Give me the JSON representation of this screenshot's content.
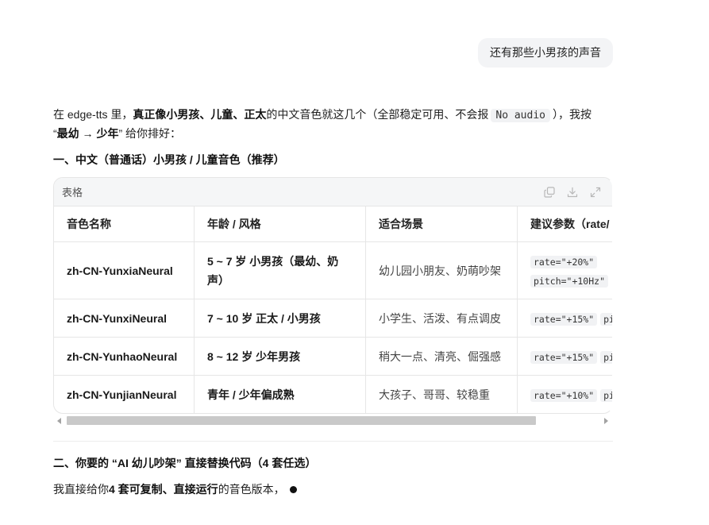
{
  "theme": {
    "page-bg": "#ffffff",
    "text": "#1f1f1f",
    "bubble-bg": "#f3f4f6",
    "code-bg": "#f1f2f4",
    "border": "#e6e6e6",
    "card-header-bg": "#f5f6f7"
  },
  "user_message": {
    "text": "还有那些小男孩的声音"
  },
  "response": {
    "intro": {
      "line1_text_a": "在 edge-tts 里，",
      "line1_bold": "真正像小男孩、儿童、正太",
      "line1_text_b": "的中文音色就这几个（全部稳定可用、不会报",
      "line1_code": "No audio",
      "line1_text_c": "），我按",
      "line2_text_a": "“",
      "line2_bold": "最幼 → 少年",
      "line2_text_b": "” 给你排好："
    },
    "section1_heading": "一、中文（普通话）小男孩 / 儿童音色（推荐）",
    "table": {
      "label": "表格",
      "action_icons": [
        "copy-icon",
        "download-icon",
        "expand-icon"
      ],
      "columns": [
        "音色名称",
        "年龄 / 风格",
        "适合场景",
        "建议参数（rate/"
      ],
      "rows": [
        {
          "voice_name": "zh-CN-YunxiaNeural",
          "age_style": "5 ~ 7 岁 小男孩（最幼、奶声）",
          "scene": "幼儿园小朋友、奶萌吵架",
          "params": [
            "rate=\"+20%\"",
            "pitch=\"+10Hz\""
          ]
        },
        {
          "voice_name": "zh-CN-YunxiNeural",
          "age_style": "7 ~ 10 岁 正太 / 小男孩",
          "scene": "小学生、活泼、有点调皮",
          "params": [
            "rate=\"+15%\"",
            "pi"
          ]
        },
        {
          "voice_name": "zh-CN-YunhaoNeural",
          "age_style": "8 ~ 12 岁 少年男孩",
          "scene": "稍大一点、清亮、倔强感",
          "params": [
            "rate=\"+15%\"",
            "pi"
          ]
        },
        {
          "voice_name": "zh-CN-YunjianNeural",
          "age_style": "青年 / 少年偏成熟",
          "scene": "大孩子、哥哥、较稳重",
          "params": [
            "rate=\"+10%\"",
            "pi"
          ]
        }
      ]
    },
    "section2_heading": "二、你要的 “AI 幼儿吵架” 直接替换代码（4 套任选）",
    "closing": {
      "text_a": "我直接给你",
      "bold": "4 套可复制、直接运行",
      "text_b": "的音色版本，"
    },
    "indicator_icon": "streaming-dot-icon"
  }
}
